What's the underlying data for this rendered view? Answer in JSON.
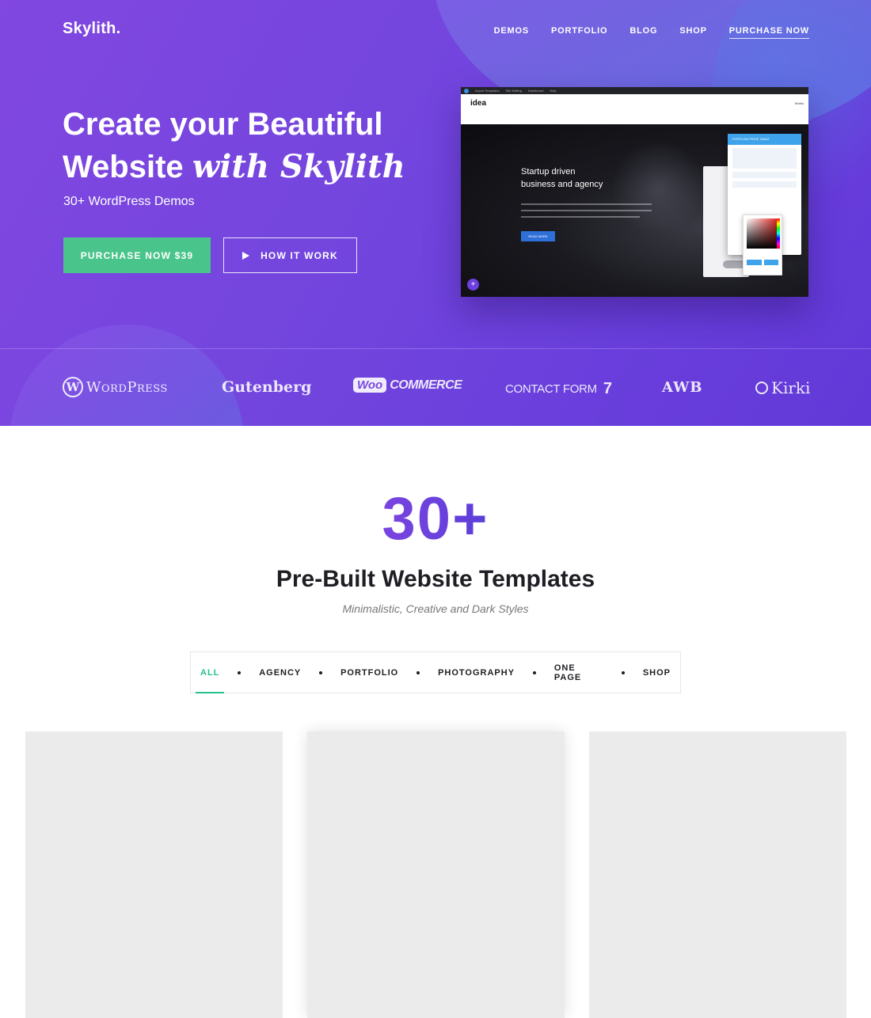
{
  "nav": {
    "logo": "Skylith.",
    "items": [
      {
        "label": "DEMOS"
      },
      {
        "label": "PORTFOLIO"
      },
      {
        "label": "BLOG"
      },
      {
        "label": "SHOP"
      },
      {
        "label": "PURCHASE NOW"
      }
    ]
  },
  "hero": {
    "title_line1": "Create your Beautiful",
    "title_line2_plain": "Website ",
    "title_line2_script": "with Skylith",
    "subtitle": "30+ WordPress Demos",
    "primary_button": "PURCHASE NOW $39",
    "secondary_button": "HOW IT WORK"
  },
  "mock": {
    "topbar_items": [
      "Import Templates",
      "Site Editing",
      "Dashboard",
      "Help"
    ],
    "logo": "idea",
    "menu": "Works",
    "headline_line1": "Startup driven",
    "headline_line2": "business and agency",
    "button": "READ MORE",
    "panel_title": "POPFLOW PRICE TABLE"
  },
  "brands": {
    "wordpress_letter": "W",
    "wordpress": "WordPress",
    "gutenberg": "Gutenberg",
    "woo": "Woo",
    "commerce": "COMMERCE",
    "contact_form": "CONTACT FORM",
    "contact_form_num": "7",
    "awb": "AWB",
    "kirki": "Kirki"
  },
  "templates": {
    "count": "30+",
    "title": "Pre-Built Website Templates",
    "subtitle": "Minimalistic, Creative and Dark Styles",
    "filters": [
      "ALL",
      "AGENCY",
      "PORTFOLIO",
      "PHOTOGRAPHY",
      "ONE PAGE",
      "SHOP"
    ],
    "active_filter": "ALL"
  },
  "colors": {
    "hero_gradient_start": "#8147e0",
    "hero_gradient_end": "#6238d8",
    "primary_button": "#49c48a",
    "accent_purple": "#6c3fdd",
    "active_filter": "#26c08a",
    "card_placeholder": "#ebebeb"
  }
}
